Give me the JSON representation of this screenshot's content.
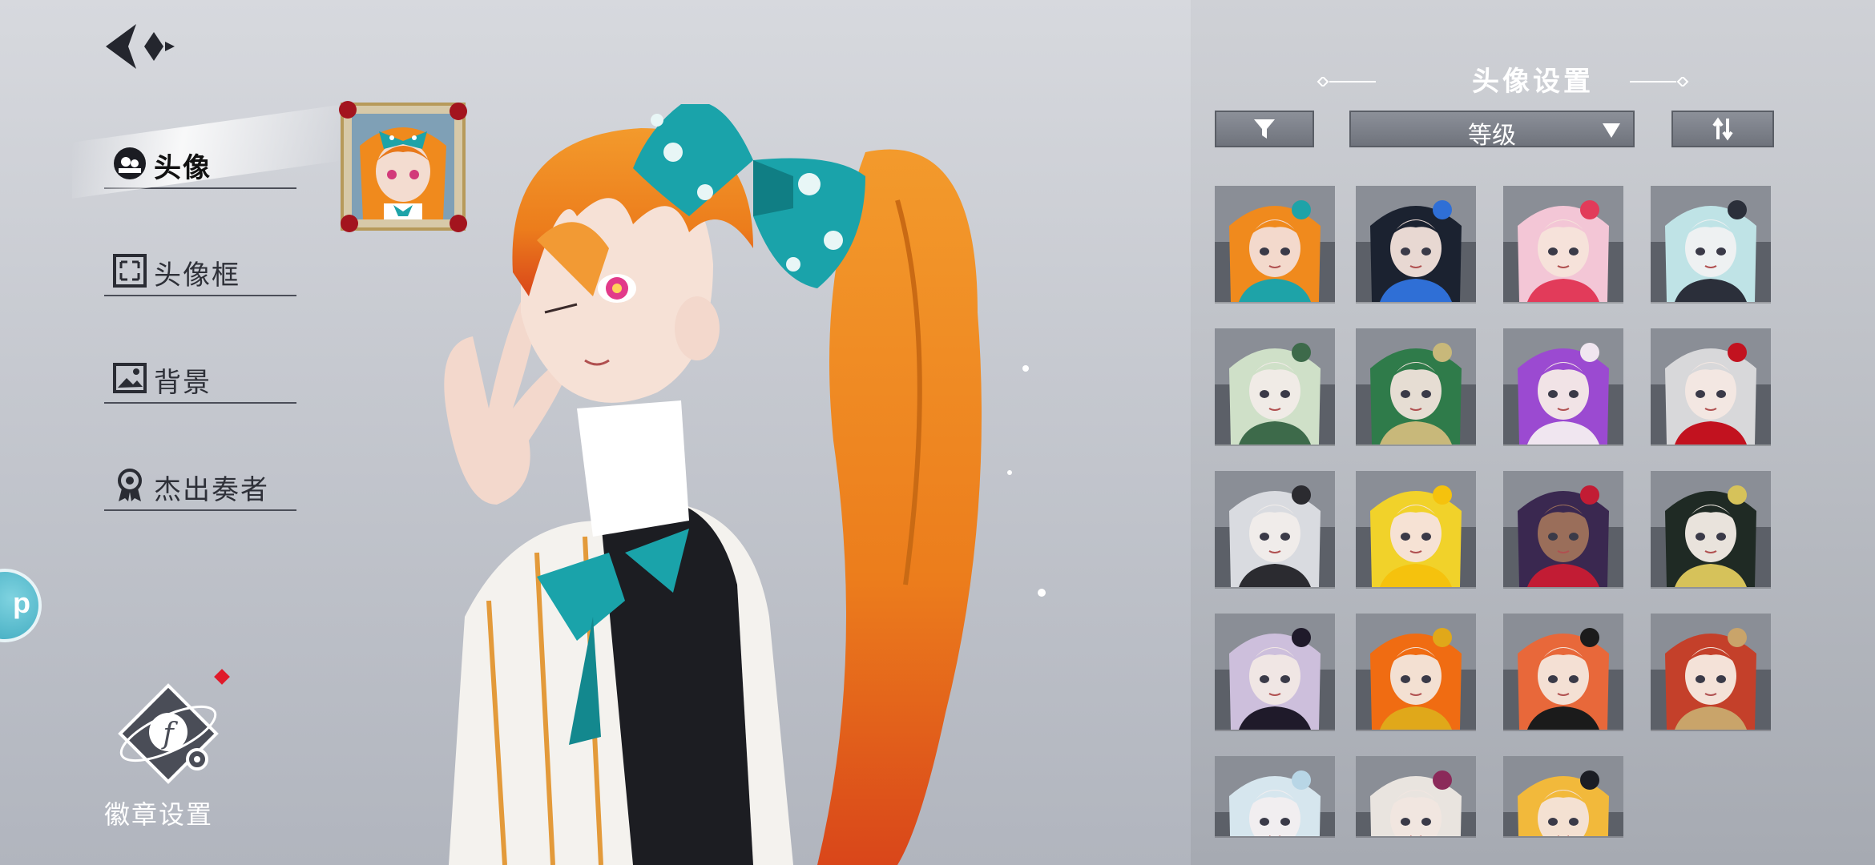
{
  "menu": {
    "items": [
      {
        "label": "头像",
        "active": true
      },
      {
        "label": "头像框",
        "active": false
      },
      {
        "label": "背景",
        "active": false
      },
      {
        "label": "杰出奏者",
        "active": false
      }
    ]
  },
  "badge_settings_label": "徽章设置",
  "side_bubble_glyph": "p",
  "panel": {
    "title": "头像设置",
    "sort_label": "等级"
  },
  "avatars": [
    {
      "hair": "#f08a1d",
      "accent": "#1ea3a8",
      "skin": "#f3d9cc"
    },
    {
      "hair": "#1b2230",
      "accent": "#2f6fd6",
      "skin": "#e8d8d2"
    },
    {
      "hair": "#f3c6d6",
      "accent": "#e23b5a",
      "skin": "#f6e2da"
    },
    {
      "hair": "#bfe3e6",
      "accent": "#2b2f3a",
      "skin": "#eef1f2"
    },
    {
      "hair": "#cfe0c8",
      "accent": "#3d6a4a",
      "skin": "#f0ebe6"
    },
    {
      "hair": "#2f7b4a",
      "accent": "#c8b87a",
      "skin": "#e6ddd3"
    },
    {
      "hair": "#9b4ad1",
      "accent": "#f0e6f0",
      "skin": "#f1e3e6"
    },
    {
      "hair": "#d8d8da",
      "accent": "#c2121f",
      "skin": "#f3e7e2"
    },
    {
      "hair": "#d9dbe0",
      "accent": "#2b2b30",
      "skin": "#f0ecea"
    },
    {
      "hair": "#f1d22a",
      "accent": "#f5c20d",
      "skin": "#f6e2d4"
    },
    {
      "hair": "#3a2850",
      "accent": "#c21c34",
      "skin": "#9a6e5a"
    },
    {
      "hair": "#1f2a24",
      "accent": "#d6c25a",
      "skin": "#e9e3dc"
    },
    {
      "hair": "#cdbfdc",
      "accent": "#1f1a2a",
      "skin": "#f0e6e4"
    },
    {
      "hair": "#f06c12",
      "accent": "#e0a81a",
      "skin": "#f3e0d2"
    },
    {
      "hair": "#e8683a",
      "accent": "#1b1b1b",
      "skin": "#f4e0d4"
    },
    {
      "hair": "#c4402a",
      "accent": "#c9a46a",
      "skin": "#f4e2d8"
    },
    {
      "hair": "#d6e6ee",
      "accent": "#b8d6e6",
      "skin": "#f1eef0"
    },
    {
      "hair": "#e9e4df",
      "accent": "#8b2a5a",
      "skin": "#f1e6e0"
    },
    {
      "hair": "#f2b93b",
      "accent": "#1b1d24",
      "skin": "#f4e1d2"
    }
  ]
}
